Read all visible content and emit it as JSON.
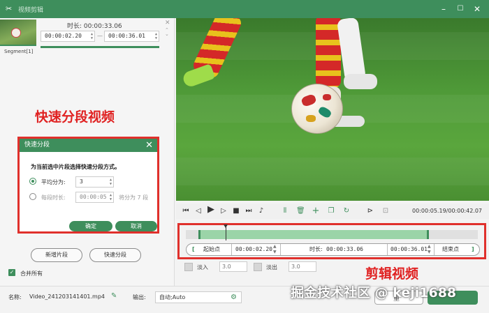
{
  "window": {
    "title": "视频剪辑",
    "min_icon": "minimize-icon",
    "max_icon": "maximize-icon",
    "close_icon": "close-icon"
  },
  "segment": {
    "label": "Segment[1]",
    "duration_label": "时长:",
    "duration": "00:00:33.06",
    "start": "00:00:02.20",
    "separator": "—",
    "end": "00:00:36.01"
  },
  "annotations": {
    "split": "快速分段视频",
    "edit": "剪辑视频"
  },
  "dialog": {
    "title": "快速分段",
    "question": "为当前选中片段选择快速分段方式。",
    "avg_label": "平均分为:",
    "avg_value": "3",
    "each_label": "每段时长:",
    "each_value": "00:00:05",
    "each_result": "将分为 7 段",
    "ok": "确定",
    "cancel": "取消"
  },
  "left_buttons": {
    "new_segment": "新增片段",
    "quick_split": "快速分段"
  },
  "merge_all": "合并所有",
  "playback": {
    "time": "00:00:05.19/00:00:42.07"
  },
  "trim": {
    "start_label": "起始点",
    "start": "00:00:02.20",
    "duration_label": "时长:",
    "duration": "00:00:33.06",
    "end": "00:00:36.01",
    "end_label": "结束点",
    "bracket_open": "[",
    "bracket_close": "]"
  },
  "fade": {
    "in_label": "淡入",
    "in_value": "3.0",
    "out_label": "淡出",
    "out_value": "3.0"
  },
  "footer": {
    "name_label": "名称:",
    "filename": "Video_241203141401.mp4",
    "output_label": "输出:",
    "output_value": "自动;Auto",
    "cancel_partial": "重",
    "watermark": "掘金技术社区 @ keji1688"
  },
  "colors": {
    "accent": "#3e8e5c",
    "annotation": "#e02222"
  }
}
